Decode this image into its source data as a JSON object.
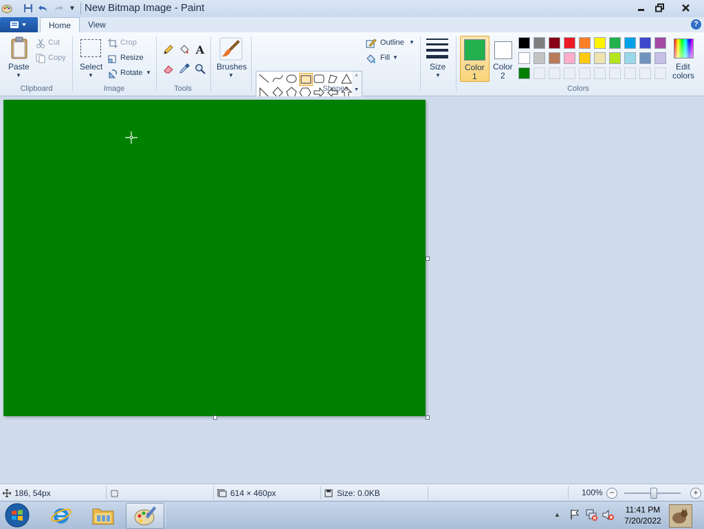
{
  "window": {
    "title": "New Bitmap Image - Paint",
    "minimize_glyph": "▬",
    "maximize_glyph": "❐",
    "close_glyph": "✕"
  },
  "ribbon_tabs": [
    {
      "label": "Home",
      "active": true
    },
    {
      "label": "View",
      "active": false
    }
  ],
  "help_label": "?",
  "clipboard": {
    "group_label": "Clipboard",
    "paste_label": "Paste",
    "cut_label": "Cut",
    "copy_label": "Copy"
  },
  "image": {
    "group_label": "Image",
    "select_label": "Select",
    "crop_label": "Crop",
    "resize_label": "Resize",
    "rotate_label": "Rotate"
  },
  "tools": {
    "group_label": "Tools",
    "text_tool_glyph": "A"
  },
  "brushes": {
    "label": "Brushes"
  },
  "shapes": {
    "group_label": "Shapes",
    "outline_label": "Outline",
    "fill_label": "Fill"
  },
  "size": {
    "label": "Size"
  },
  "colors": {
    "group_label": "Colors",
    "color1_label": "Color",
    "color1_num": "1",
    "color2_label": "Color",
    "color2_num": "2",
    "edit_label": "Edit",
    "edit_label2": "colors",
    "color1_value": "#22b14c",
    "color2_value": "#ffffff",
    "palette_row1": [
      "#000000",
      "#7f7f7f",
      "#880015",
      "#ed1c24",
      "#ff7f27",
      "#fff200",
      "#22b14c",
      "#00a2e8",
      "#3f48cc",
      "#a349a4"
    ],
    "palette_row2": [
      "#ffffff",
      "#c3c3c3",
      "#b97a57",
      "#ffaec9",
      "#ffc90e",
      "#efe4b0",
      "#b5e61d",
      "#99d9ea",
      "#7092be",
      "#c8bfe7"
    ],
    "palette_row3": [
      "#008000",
      "",
      "",
      "",
      "",
      "",
      "",
      "",
      "",
      ""
    ]
  },
  "canvas": {
    "fill_color": "#008000"
  },
  "statusbar": {
    "cursor_pos": "186, 54px",
    "selection_size": "",
    "image_size": "614 × 460px",
    "file_size": "Size: 0.0KB",
    "zoom": "100%"
  },
  "taskbar": {
    "time": "11:41 PM",
    "date": "7/20/2022"
  }
}
